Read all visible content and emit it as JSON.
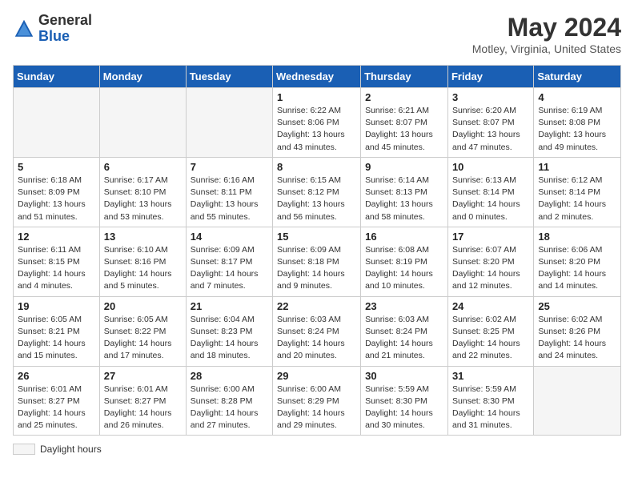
{
  "header": {
    "logo_general": "General",
    "logo_blue": "Blue",
    "title": "May 2024",
    "location": "Motley, Virginia, United States"
  },
  "legend": {
    "label": "Daylight hours"
  },
  "weekdays": [
    "Sunday",
    "Monday",
    "Tuesday",
    "Wednesday",
    "Thursday",
    "Friday",
    "Saturday"
  ],
  "weeks": [
    [
      {
        "day": "",
        "info": ""
      },
      {
        "day": "",
        "info": ""
      },
      {
        "day": "",
        "info": ""
      },
      {
        "day": "1",
        "info": "Sunrise: 6:22 AM\nSunset: 8:06 PM\nDaylight: 13 hours\nand 43 minutes."
      },
      {
        "day": "2",
        "info": "Sunrise: 6:21 AM\nSunset: 8:07 PM\nDaylight: 13 hours\nand 45 minutes."
      },
      {
        "day": "3",
        "info": "Sunrise: 6:20 AM\nSunset: 8:07 PM\nDaylight: 13 hours\nand 47 minutes."
      },
      {
        "day": "4",
        "info": "Sunrise: 6:19 AM\nSunset: 8:08 PM\nDaylight: 13 hours\nand 49 minutes."
      }
    ],
    [
      {
        "day": "5",
        "info": "Sunrise: 6:18 AM\nSunset: 8:09 PM\nDaylight: 13 hours\nand 51 minutes."
      },
      {
        "day": "6",
        "info": "Sunrise: 6:17 AM\nSunset: 8:10 PM\nDaylight: 13 hours\nand 53 minutes."
      },
      {
        "day": "7",
        "info": "Sunrise: 6:16 AM\nSunset: 8:11 PM\nDaylight: 13 hours\nand 55 minutes."
      },
      {
        "day": "8",
        "info": "Sunrise: 6:15 AM\nSunset: 8:12 PM\nDaylight: 13 hours\nand 56 minutes."
      },
      {
        "day": "9",
        "info": "Sunrise: 6:14 AM\nSunset: 8:13 PM\nDaylight: 13 hours\nand 58 minutes."
      },
      {
        "day": "10",
        "info": "Sunrise: 6:13 AM\nSunset: 8:14 PM\nDaylight: 14 hours\nand 0 minutes."
      },
      {
        "day": "11",
        "info": "Sunrise: 6:12 AM\nSunset: 8:14 PM\nDaylight: 14 hours\nand 2 minutes."
      }
    ],
    [
      {
        "day": "12",
        "info": "Sunrise: 6:11 AM\nSunset: 8:15 PM\nDaylight: 14 hours\nand 4 minutes."
      },
      {
        "day": "13",
        "info": "Sunrise: 6:10 AM\nSunset: 8:16 PM\nDaylight: 14 hours\nand 5 minutes."
      },
      {
        "day": "14",
        "info": "Sunrise: 6:09 AM\nSunset: 8:17 PM\nDaylight: 14 hours\nand 7 minutes."
      },
      {
        "day": "15",
        "info": "Sunrise: 6:09 AM\nSunset: 8:18 PM\nDaylight: 14 hours\nand 9 minutes."
      },
      {
        "day": "16",
        "info": "Sunrise: 6:08 AM\nSunset: 8:19 PM\nDaylight: 14 hours\nand 10 minutes."
      },
      {
        "day": "17",
        "info": "Sunrise: 6:07 AM\nSunset: 8:20 PM\nDaylight: 14 hours\nand 12 minutes."
      },
      {
        "day": "18",
        "info": "Sunrise: 6:06 AM\nSunset: 8:20 PM\nDaylight: 14 hours\nand 14 minutes."
      }
    ],
    [
      {
        "day": "19",
        "info": "Sunrise: 6:05 AM\nSunset: 8:21 PM\nDaylight: 14 hours\nand 15 minutes."
      },
      {
        "day": "20",
        "info": "Sunrise: 6:05 AM\nSunset: 8:22 PM\nDaylight: 14 hours\nand 17 minutes."
      },
      {
        "day": "21",
        "info": "Sunrise: 6:04 AM\nSunset: 8:23 PM\nDaylight: 14 hours\nand 18 minutes."
      },
      {
        "day": "22",
        "info": "Sunrise: 6:03 AM\nSunset: 8:24 PM\nDaylight: 14 hours\nand 20 minutes."
      },
      {
        "day": "23",
        "info": "Sunrise: 6:03 AM\nSunset: 8:24 PM\nDaylight: 14 hours\nand 21 minutes."
      },
      {
        "day": "24",
        "info": "Sunrise: 6:02 AM\nSunset: 8:25 PM\nDaylight: 14 hours\nand 22 minutes."
      },
      {
        "day": "25",
        "info": "Sunrise: 6:02 AM\nSunset: 8:26 PM\nDaylight: 14 hours\nand 24 minutes."
      }
    ],
    [
      {
        "day": "26",
        "info": "Sunrise: 6:01 AM\nSunset: 8:27 PM\nDaylight: 14 hours\nand 25 minutes."
      },
      {
        "day": "27",
        "info": "Sunrise: 6:01 AM\nSunset: 8:27 PM\nDaylight: 14 hours\nand 26 minutes."
      },
      {
        "day": "28",
        "info": "Sunrise: 6:00 AM\nSunset: 8:28 PM\nDaylight: 14 hours\nand 27 minutes."
      },
      {
        "day": "29",
        "info": "Sunrise: 6:00 AM\nSunset: 8:29 PM\nDaylight: 14 hours\nand 29 minutes."
      },
      {
        "day": "30",
        "info": "Sunrise: 5:59 AM\nSunset: 8:30 PM\nDaylight: 14 hours\nand 30 minutes."
      },
      {
        "day": "31",
        "info": "Sunrise: 5:59 AM\nSunset: 8:30 PM\nDaylight: 14 hours\nand 31 minutes."
      },
      {
        "day": "",
        "info": ""
      }
    ]
  ]
}
